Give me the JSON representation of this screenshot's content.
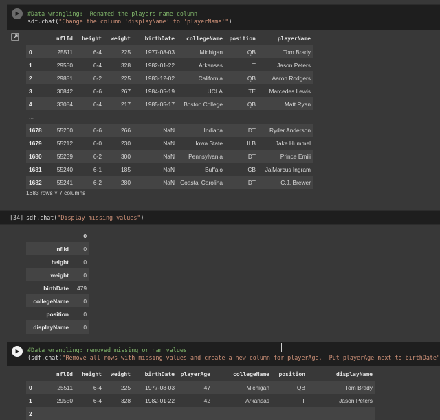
{
  "cells": {
    "c1": {
      "comment": "#Data wrangling:  Renamed the players name column",
      "code_prefix": "sdf.chat(",
      "code_string": "\"Change the column 'displayName' to 'playerName'\"",
      "code_suffix": ")"
    },
    "c2": {
      "exec_count": "[34]",
      "code_prefix": "sdf.chat(",
      "code_string": "\"Display missing values\"",
      "code_suffix": ")"
    },
    "c3": {
      "comment": "#Data wrangling: removed missing or nan values",
      "code_prefix": "(sdf.chat(",
      "code_string": "\"Remove all rows with missing values and create a new column for playerAge.  Put playerAge next to birthDate\"",
      "code_suffix": "))"
    }
  },
  "table1": {
    "columns": [
      "",
      "nflId",
      "height",
      "weight",
      "birthDate",
      "collegeName",
      "position",
      "playerName"
    ],
    "rows": [
      [
        "0",
        "25511",
        "6-4",
        "225",
        "1977-08-03",
        "Michigan",
        "QB",
        "Tom Brady"
      ],
      [
        "1",
        "29550",
        "6-4",
        "328",
        "1982-01-22",
        "Arkansas",
        "T",
        "Jason Peters"
      ],
      [
        "2",
        "29851",
        "6-2",
        "225",
        "1983-12-02",
        "California",
        "QB",
        "Aaron Rodgers"
      ],
      [
        "3",
        "30842",
        "6-6",
        "267",
        "1984-05-19",
        "UCLA",
        "TE",
        "Marcedes Lewis"
      ],
      [
        "4",
        "33084",
        "6-4",
        "217",
        "1985-05-17",
        "Boston College",
        "QB",
        "Matt Ryan"
      ],
      [
        "...",
        "...",
        "...",
        "...",
        "...",
        "...",
        "...",
        "..."
      ],
      [
        "1678",
        "55200",
        "6-6",
        "266",
        "NaN",
        "Indiana",
        "DT",
        "Ryder Anderson"
      ],
      [
        "1679",
        "55212",
        "6-0",
        "230",
        "NaN",
        "Iowa State",
        "ILB",
        "Jake Hummel"
      ],
      [
        "1680",
        "55239",
        "6-2",
        "300",
        "NaN",
        "Pennsylvania",
        "DT",
        "Prince Emili"
      ],
      [
        "1681",
        "55240",
        "6-1",
        "185",
        "NaN",
        "Buffalo",
        "CB",
        "Ja'Marcus Ingram"
      ],
      [
        "1682",
        "55241",
        "6-2",
        "280",
        "NaN",
        "Coastal Carolina",
        "DT",
        "C.J. Brewer"
      ]
    ],
    "footer": "1683 rows × 7 columns"
  },
  "missing": {
    "header": "0",
    "rows": [
      [
        "nflId",
        "0"
      ],
      [
        "height",
        "0"
      ],
      [
        "weight",
        "0"
      ],
      [
        "birthDate",
        "479"
      ],
      [
        "collegeName",
        "0"
      ],
      [
        "position",
        "0"
      ],
      [
        "displayName",
        "0"
      ]
    ]
  },
  "table3": {
    "columns": [
      "",
      "nflId",
      "height",
      "weight",
      "birthDate",
      "playerAge",
      "collegeName",
      "position",
      "displayName"
    ],
    "rows": [
      [
        "0",
        "25511",
        "6-4",
        "225",
        "1977-08-03",
        "47",
        "Michigan",
        "QB",
        "Tom Brady"
      ],
      [
        "1",
        "29550",
        "6-4",
        "328",
        "1982-01-22",
        "42",
        "Arkansas",
        "T",
        "Jason Peters"
      ],
      [
        "2",
        "",
        "",
        "",
        "",
        "",
        "",
        "",
        ""
      ]
    ]
  }
}
